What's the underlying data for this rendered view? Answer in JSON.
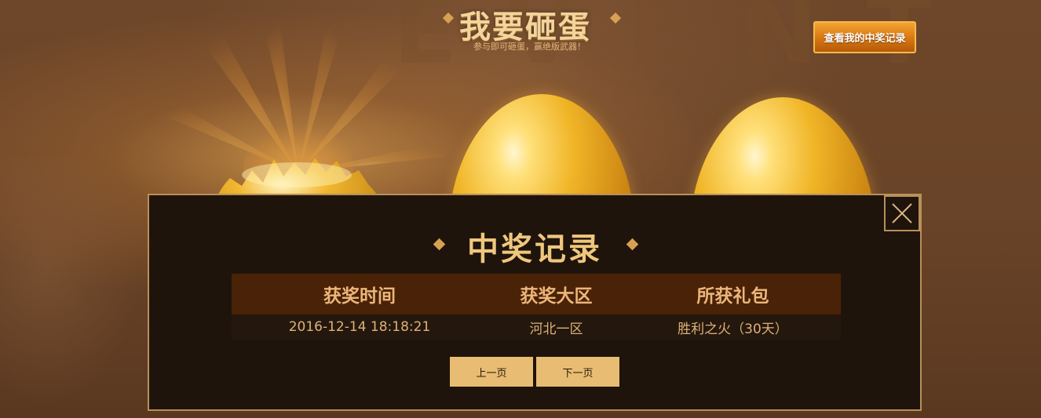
{
  "header": {
    "title": "我要砸蛋",
    "subtitle": "参与即可砸蛋，赢绝版武器！",
    "record_button": "查看我的中奖记录"
  },
  "colors": {
    "accent": "#e8bc72",
    "modal_bg": "#1f140b",
    "modal_border": "#b8905a",
    "table_header_bg": "#4a2207",
    "record_button": "#d97a12"
  },
  "modal": {
    "title": "中奖记录",
    "close_icon": "close-icon",
    "columns": [
      "获奖时间",
      "获奖大区",
      "所获礼包"
    ],
    "rows": [
      {
        "time": "2016-12-14 18:18:21",
        "zone": "河北一区",
        "gift": "胜利之火（30天）"
      }
    ],
    "prev_label": "上一页",
    "next_label": "下一页"
  }
}
